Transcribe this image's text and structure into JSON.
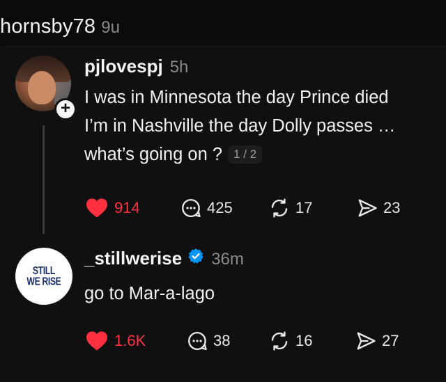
{
  "top": {
    "username": "hornsby78",
    "time": "9u"
  },
  "reply1": {
    "username": "pjlovespj",
    "time": "5h",
    "lines": [
      "I was in Minnesota the day Prince died",
      "I’m in Nashville the day Dolly passes …",
      "what’s going on ?"
    ],
    "counter": "1 / 2",
    "likes": "914",
    "comments": "425",
    "reposts": "17",
    "shares": "23"
  },
  "reply2": {
    "username": "_stillwerise",
    "time": "36m",
    "avatar_text": [
      "STILL",
      "WE RISE"
    ],
    "text": "go to Mar-a-lago",
    "likes": "1.6K",
    "comments": "38",
    "reposts": "16",
    "shares": "27"
  },
  "colors": {
    "like": "#ff3040",
    "verified": "#0095f6",
    "background": "#0b0b0c"
  },
  "icons": [
    "heart-icon",
    "comment-icon",
    "repost-icon",
    "share-icon",
    "plus-icon",
    "verified-badge-icon"
  ]
}
